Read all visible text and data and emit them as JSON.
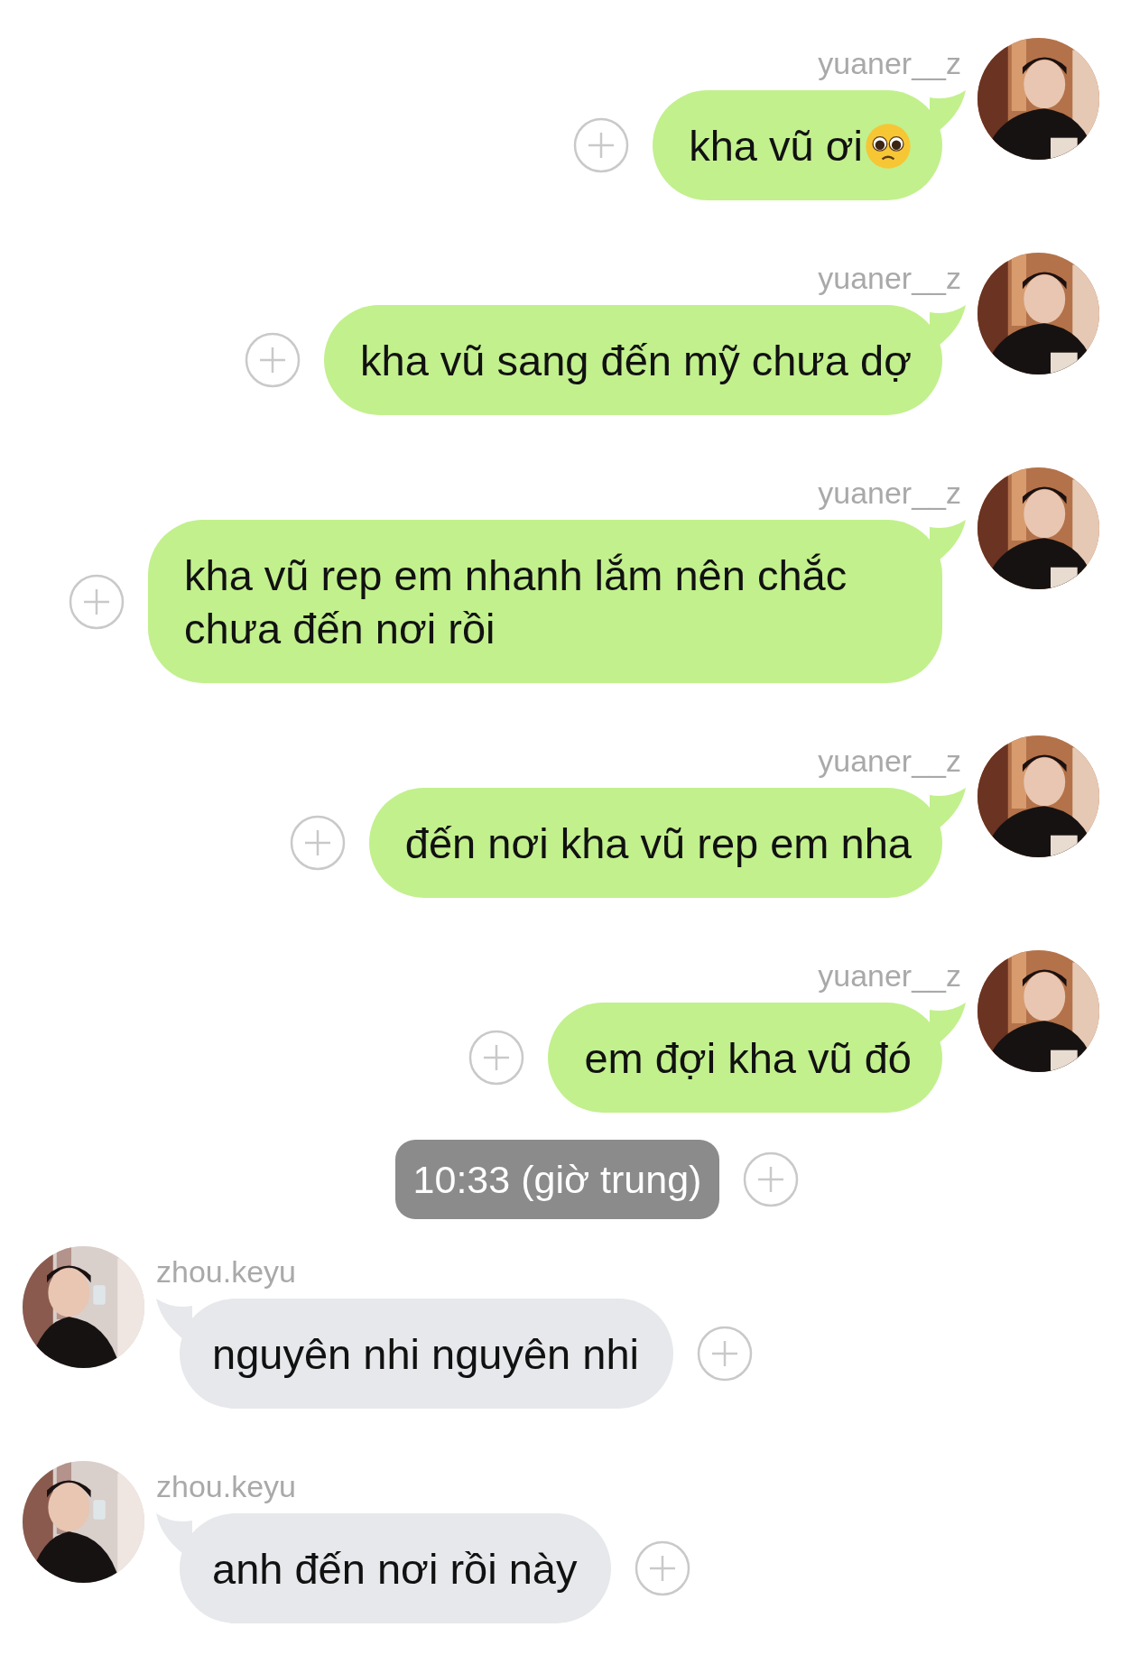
{
  "messages": [
    {
      "kind": "outgoing",
      "sender": "yuaner__z",
      "text": "kha vũ ơi",
      "emoji": true
    },
    {
      "kind": "outgoing",
      "sender": "yuaner__z",
      "text": "kha vũ sang đến mỹ chưa dợ"
    },
    {
      "kind": "outgoing",
      "sender": "yuaner__z",
      "text": "kha vũ rep em nhanh lắm nên chắc chưa đến nơi rồi"
    },
    {
      "kind": "outgoing",
      "sender": "yuaner__z",
      "text": "đến nơi kha vũ rep em nha"
    },
    {
      "kind": "outgoing",
      "sender": "yuaner__z",
      "text": "em đợi kha vũ đó"
    },
    {
      "kind": "time",
      "text": "10:33 (giờ trung)"
    },
    {
      "kind": "incoming",
      "sender": "zhou.keyu",
      "text": "nguyên nhi nguyên nhi"
    },
    {
      "kind": "incoming",
      "sender": "zhou.keyu",
      "text": "anh đến nơi rồi này"
    }
  ]
}
